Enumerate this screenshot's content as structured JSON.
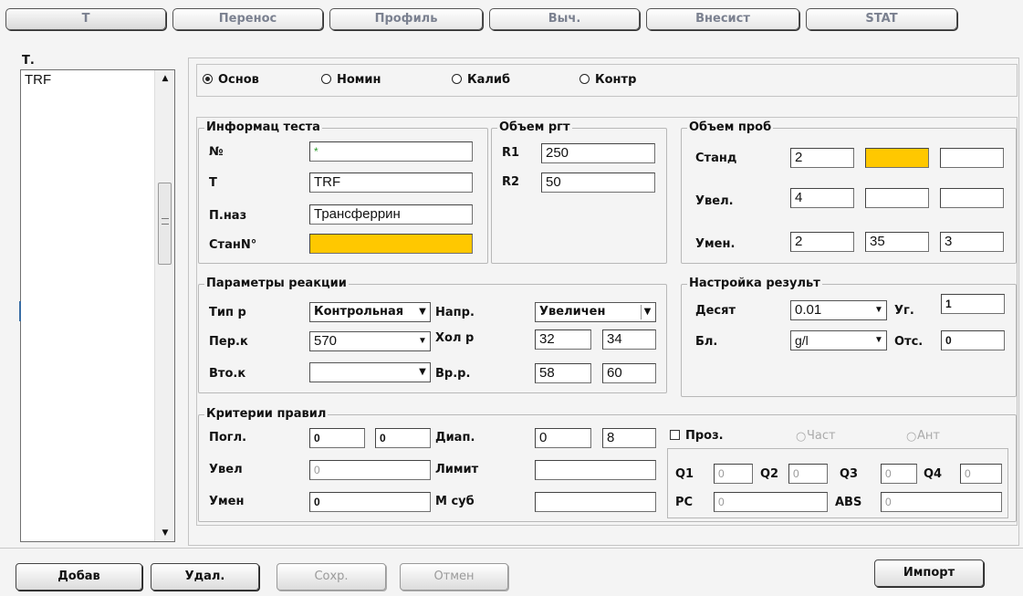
{
  "tabs": [
    "Т",
    "Перенос",
    "Профиль",
    "Выч.",
    "Внесист",
    "STAT"
  ],
  "left_panel": {
    "title": "Т.",
    "items": [
      "TRF"
    ]
  },
  "mode_radios": [
    {
      "label": "Основ",
      "selected": true
    },
    {
      "label": "Номин",
      "selected": false
    },
    {
      "label": "Калиб",
      "selected": false
    },
    {
      "label": "Контр",
      "selected": false
    }
  ],
  "test_info": {
    "title": "Информац теста",
    "no_label": "№",
    "no_value": "*",
    "t_label": "Т",
    "t_value": "TRF",
    "name_label": "П.наз",
    "name_value": "Трансферрин",
    "std_label": "СтанN°",
    "std_value": ""
  },
  "reagent_volume": {
    "title": "Объем ргт",
    "r1_label": "R1",
    "r1_value": "250",
    "r2_label": "R2",
    "r2_value": "50"
  },
  "sample_volume": {
    "title": "Объем проб",
    "std_label": "Станд",
    "std_values": [
      "2",
      "",
      ""
    ],
    "inc_label": "Увел.",
    "inc_values": [
      "4",
      "",
      ""
    ],
    "dec_label": "Умен.",
    "dec_values": [
      "2",
      "35",
      "3"
    ]
  },
  "reaction": {
    "title": "Параметры реакции",
    "type_label": "Тип р",
    "type_value": "Контрольная",
    "dir_label": "Напр.",
    "dir_value": "Увеличен",
    "first_label": "Пер.к",
    "first_value": "570",
    "cold_label": "Хол р",
    "cold_values": [
      "32",
      "34"
    ],
    "second_label": "Вто.к",
    "second_value": "",
    "time_label": "Вр.р.",
    "time_values": [
      "58",
      "60"
    ]
  },
  "result_setup": {
    "title": "Настройка результ",
    "dec_label": "Десят",
    "dec_value": "0.01",
    "angle_label": "Уг.",
    "angle_value": "1",
    "unit_label": "Бл.",
    "unit_value": "g/l",
    "off_label": "Отс.",
    "off_value": "0"
  },
  "rules": {
    "title": "Критерии правил",
    "abs_label": "Погл.",
    "abs_values": [
      "0",
      "0"
    ],
    "range_label": "Диап.",
    "range_values": [
      "0",
      "8"
    ],
    "inc_label": "Увел",
    "inc_value": "0",
    "limit_label": "Лимит",
    "limit_value": "",
    "dec_label": "Умен",
    "dec_value": "0",
    "sub_label": "М суб",
    "sub_value": "",
    "proz_label": "Проз.",
    "freq_label": "Част",
    "ant_label": "Ант",
    "q1_label": "Q1",
    "q1_value": "0",
    "q2_label": "Q2",
    "q2_value": "0",
    "q3_label": "Q3",
    "q3_value": "0",
    "q4_label": "Q4",
    "q4_value": "0",
    "pc_label": "PC",
    "pc_value": "0",
    "absb_label": "ABS",
    "absb_value": "0"
  },
  "buttons": {
    "add": "Добав",
    "delete": "Удал.",
    "save": "Сохр.",
    "cancel": "Отмен",
    "import": "Импорт"
  },
  "colors": {
    "highlight": "#ffc800"
  }
}
